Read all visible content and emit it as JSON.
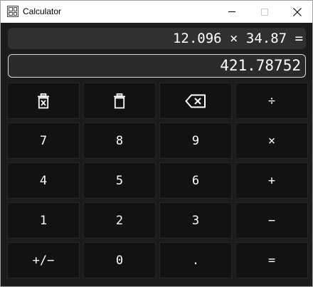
{
  "window": {
    "title": "Calculator",
    "icon": "calculator-icon",
    "controls": [
      "minimize-icon",
      "maximize-icon",
      "close-icon"
    ]
  },
  "display": {
    "expression": "12.096 × 34.87 =",
    "result": "421.78752"
  },
  "keys": {
    "clear_all": {
      "icon": "clear-all-icon"
    },
    "clear": {
      "icon": "clear-icon"
    },
    "backspace": {
      "icon": "backspace-icon"
    },
    "divide": "÷",
    "seven": "7",
    "eight": "8",
    "nine": "9",
    "multiply": "×",
    "four": "4",
    "five": "5",
    "six": "6",
    "plus": "+",
    "one": "1",
    "two": "2",
    "three": "3",
    "minus": "−",
    "negate": "+/−",
    "zero": "0",
    "decimal": ".",
    "equals": "="
  },
  "colors": {
    "background": "#1c1c1c",
    "key": "#121212",
    "display": "#303030",
    "text": "#ffffff"
  }
}
